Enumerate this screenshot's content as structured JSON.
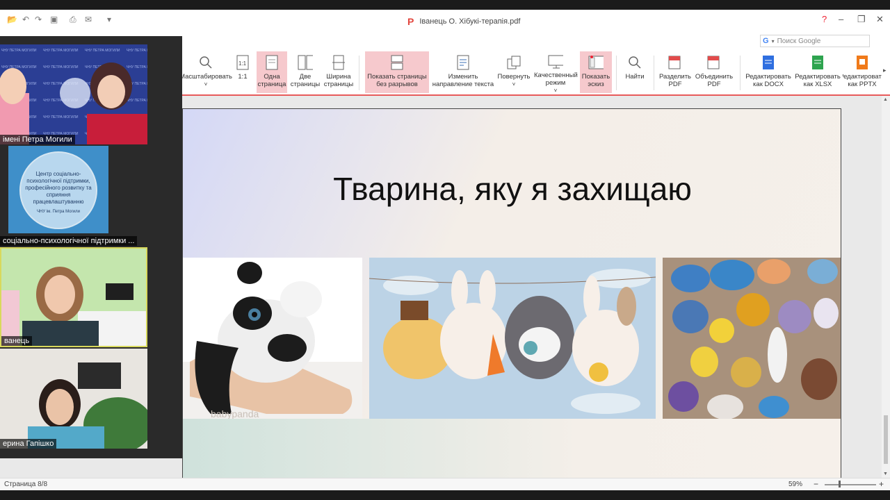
{
  "window": {
    "title": "Іванець О. Хібукі-терапія.pdf",
    "app_glyph": "P",
    "search_placeholder": "Поиск Google",
    "search_engine": "G"
  },
  "ribbon": [
    {
      "label": "Масштабировать",
      "icon": "zoom-icon"
    },
    {
      "label": "1:1",
      "icon": "actual-size-icon"
    },
    {
      "label": "Одна страница",
      "icon": "single-page-icon",
      "active": true
    },
    {
      "label": "Две страницы",
      "icon": "two-pages-icon"
    },
    {
      "label": "Ширина страницы",
      "icon": "fit-width-icon"
    },
    {
      "label": "Показать страницы без разрывов",
      "icon": "continuous-pages-icon",
      "active": true
    },
    {
      "label": "Изменить направление текста",
      "icon": "text-direction-icon"
    },
    {
      "label": "Повернуть",
      "icon": "rotate-icon"
    },
    {
      "label": "Качественный режим",
      "icon": "quality-mode-icon"
    },
    {
      "label": "Показать эскиз",
      "icon": "thumbnail-icon",
      "active": true
    },
    {
      "label": "Найти",
      "icon": "find-icon"
    },
    {
      "label": "Разделить PDF",
      "icon": "split-pdf-icon"
    },
    {
      "label": "Объединить PDF",
      "icon": "merge-pdf-icon"
    },
    {
      "label": "Редактировать как DOCX",
      "icon": "docx-icon"
    },
    {
      "label": "Редактировать как XLSX",
      "icon": "xlsx-icon"
    },
    {
      "label": "Редактировать как PPTX",
      "icon": "pptx-icon"
    }
  ],
  "slide": {
    "title": "Тварина, яку я захищаю",
    "photo_watermark": "babypanda"
  },
  "statusbar": {
    "page": "Страница 8/8",
    "zoom": "59%"
  },
  "meeting": {
    "participants": [
      {
        "name": "імені Петра Могили"
      },
      {
        "name": "соціально-психологічної підтримки ..."
      },
      {
        "name": "ванець"
      },
      {
        "name": "ерина Гапішко"
      }
    ],
    "center_logo_text": "Центр соціально-психологічної підтримки, професійного розвитку та сприяння працевлаштуванню",
    "center_logo_sub": "ЧНУ ім. Петра Могили"
  }
}
